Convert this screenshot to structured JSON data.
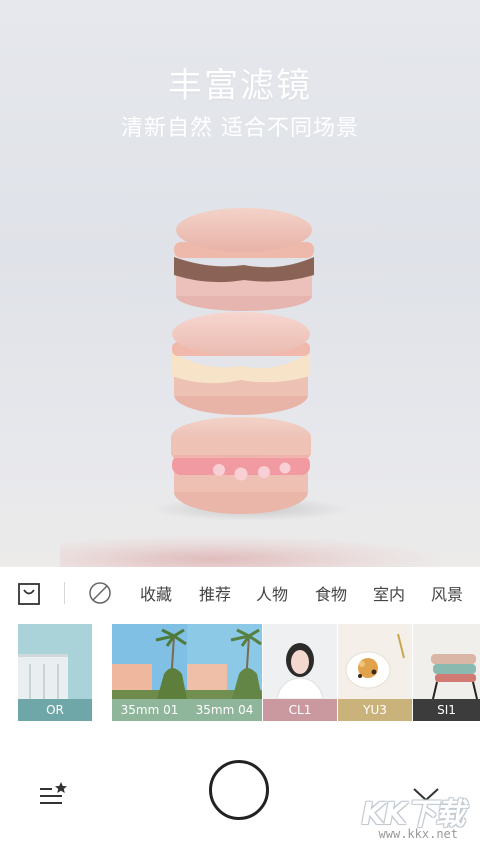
{
  "hero": {
    "title": "丰富滤镜",
    "subtitle": "清新自然 适合不同场景"
  },
  "category_bar": {
    "store_icon": "shopping-bag-icon",
    "no_filter_icon": "no-filter-circle-slash-icon",
    "tabs": [
      "收藏",
      "推荐",
      "人物",
      "食物",
      "室内",
      "风景"
    ]
  },
  "filters": [
    {
      "label": "OR",
      "label_color": "#6fa6a8"
    },
    {
      "label": "35mm 01",
      "label_color": "#8fb59b"
    },
    {
      "label": "35mm 04",
      "label_color": "#8fb59b"
    },
    {
      "label": "CL1",
      "label_color": "#c9999f"
    },
    {
      "label": "YU3",
      "label_color": "#c9b37a"
    },
    {
      "label": "SI1",
      "label_color": "#3c3c3c"
    }
  ],
  "bottom_bar": {
    "left_icon": "list-star-icon",
    "center_icon": "shutter-button",
    "right_icon": "chevron-down-icon"
  },
  "watermark": {
    "logo": "KK下载",
    "url": "www.kkx.net"
  }
}
